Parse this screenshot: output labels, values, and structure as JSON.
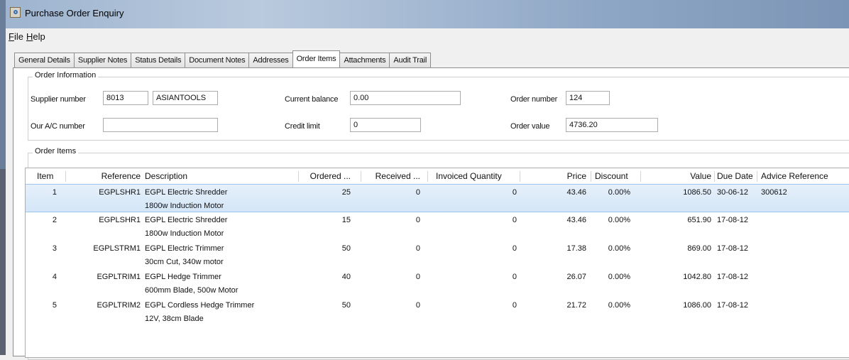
{
  "window": {
    "title": "Purchase Order Enquiry",
    "icon": "document-search-icon"
  },
  "menu": {
    "file": "File",
    "help": "Help"
  },
  "tabs": [
    "General Details",
    "Supplier Notes",
    "Status Details",
    "Document Notes",
    "Addresses",
    "Order Items",
    "Attachments",
    "Audit Trail"
  ],
  "active_tab": "Order Items",
  "order_info": {
    "title": "Order Information",
    "supplier_number_label": "Supplier number",
    "supplier_number": "8013",
    "supplier_name": "ASIANTOOLS",
    "our_ac_label": "Our A/C number",
    "our_ac": "",
    "current_balance_label": "Current balance",
    "current_balance": "0.00",
    "credit_limit_label": "Credit limit",
    "credit_limit": "0",
    "order_number_label": "Order number",
    "order_number": "124",
    "order_value_label": "Order value",
    "order_value": "4736.20"
  },
  "order_items": {
    "title": "Order Items",
    "columns": [
      "Item",
      "Reference",
      "Description",
      "Ordered ...",
      "Received ...",
      "Invoiced Quantity",
      "Price",
      "Discount",
      "Value",
      "Due Date",
      "Advice Reference"
    ],
    "rows": [
      {
        "item": "1",
        "reference": "EGPLSHR1",
        "description": "EGPL Electric Shredder",
        "detail": "1800w Induction Motor",
        "ordered": "25",
        "received": "0",
        "invoiced": "0",
        "price": "43.46",
        "discount": "0.00%",
        "value": "1086.50",
        "due_date": "30-06-12",
        "advice": "300612"
      },
      {
        "item": "2",
        "reference": "EGPLSHR1",
        "description": "EGPL Electric Shredder",
        "detail": "1800w Induction Motor",
        "ordered": "15",
        "received": "0",
        "invoiced": "0",
        "price": "43.46",
        "discount": "0.00%",
        "value": "651.90",
        "due_date": "17-08-12",
        "advice": ""
      },
      {
        "item": "3",
        "reference": "EGPLSTRM1",
        "description": "EGPL Electric Trimmer",
        "detail": "30cm Cut, 340w motor",
        "ordered": "50",
        "received": "0",
        "invoiced": "0",
        "price": "17.38",
        "discount": "0.00%",
        "value": "869.00",
        "due_date": "17-08-12",
        "advice": ""
      },
      {
        "item": "4",
        "reference": "EGPLTRIM1",
        "description": "EGPL Hedge Trimmer",
        "detail": "600mm Blade, 500w Motor",
        "ordered": "40",
        "received": "0",
        "invoiced": "0",
        "price": "26.07",
        "discount": "0.00%",
        "value": "1042.80",
        "due_date": "17-08-12",
        "advice": ""
      },
      {
        "item": "5",
        "reference": "EGPLTRIM2",
        "description": "EGPL Cordless Hedge Trimmer",
        "detail": "12V, 38cm Blade",
        "ordered": "50",
        "received": "0",
        "invoiced": "0",
        "price": "21.72",
        "discount": "0.00%",
        "value": "1086.00",
        "due_date": "17-08-12",
        "advice": ""
      }
    ]
  }
}
